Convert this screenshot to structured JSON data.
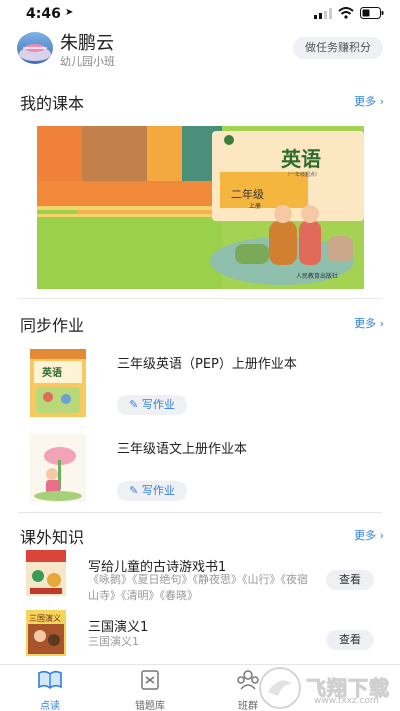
{
  "status": {
    "time": "4:46"
  },
  "header": {
    "name": "朱鹏云",
    "class_name": "幼儿园小班",
    "task_button": "做任务赚积分"
  },
  "textbooks": {
    "title": "我的课本",
    "more": "更多",
    "cover": {
      "subject": "英语",
      "edition": "（一年级起点）",
      "grade": "二年级",
      "volume": "上册",
      "publisher": "人民教育出版社"
    }
  },
  "homework": {
    "title": "同步作业",
    "more": "更多",
    "items": [
      {
        "title": "三年级英语（PEP）上册作业本",
        "action": "写作业",
        "thumb_label": "英语"
      },
      {
        "title": "三年级语文上册作业本",
        "action": "写作业"
      }
    ]
  },
  "extra": {
    "title": "课外知识",
    "more": "更多",
    "items": [
      {
        "title": "写给儿童的古诗游戏书1",
        "desc": "《咏鹅》《夏日绝句》《静夜思》《山行》《夜宿山寺》《清明》《春晓》",
        "action": "查看"
      },
      {
        "title": "三国演义1",
        "desc": "三国演义1",
        "action": "查看",
        "thumb_label": "三国演义"
      }
    ]
  },
  "tabbar": {
    "tabs": [
      {
        "label": "点读",
        "active": true
      },
      {
        "label": "错题库",
        "active": false
      },
      {
        "label": "班群",
        "active": false
      }
    ]
  },
  "watermark": {
    "text": "飞翔下载",
    "url": "www.fxxz.com"
  },
  "colors": {
    "accent": "#2f7fe0",
    "pill_bg": "#eef0f3"
  }
}
